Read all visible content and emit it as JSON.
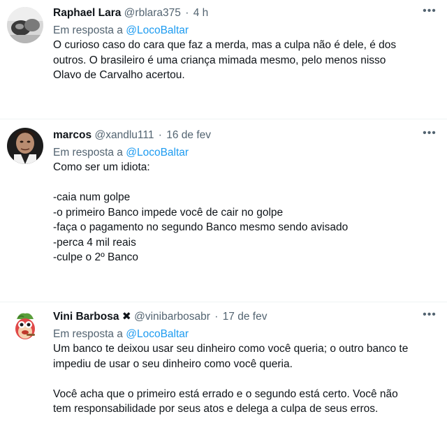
{
  "tweets": [
    {
      "name": "Raphael Lara",
      "handle": "@rblara375",
      "separator": "·",
      "time": "4 h",
      "reply_prefix": "Em resposta a",
      "reply_mention": "@LocoBaltar",
      "text": "O curioso caso do cara que faz a merda, mas a culpa não é dele, é dos\noutros. O brasileiro é uma criança mimada mesmo, pelo menos nisso\nOlavo de Carvalho acertou.",
      "more_icon": "more-dots-icon"
    },
    {
      "name": "marcos",
      "handle": "@xandlu111",
      "separator": "·",
      "time": "16 de fev",
      "reply_prefix": "Em resposta a",
      "reply_mention": "@LocoBaltar",
      "text": "Como ser um idiota:\n\n-caia num golpe\n-o primeiro Banco impede você de cair no golpe\n-faça o pagamento no segundo Banco mesmo sendo avisado\n-perca 4 mil reais\n-culpe o 2º Banco",
      "more_icon": "more-dots-icon"
    },
    {
      "name": "Vini Barbosa",
      "badge": "✖",
      "handle": "@vinibarbosabr",
      "separator": "·",
      "time": "17 de fev",
      "reply_prefix": "Em resposta a",
      "reply_mention": "@LocoBaltar",
      "text": "Um banco te deixou usar seu dinheiro como você queria; o outro banco te\nimpediu de usar o seu dinheiro como você queria.\n\nVocê acha que o primeiro está errado e o segundo está certo. Você não\ntem responsabilidade por seus atos e delega a culpa de seus erros.",
      "more_icon": "more-dots-icon"
    }
  ],
  "colors": {
    "text": "#0f1419",
    "secondary": "#536471",
    "link": "#1d9bf0",
    "divider": "#eff3f4"
  }
}
